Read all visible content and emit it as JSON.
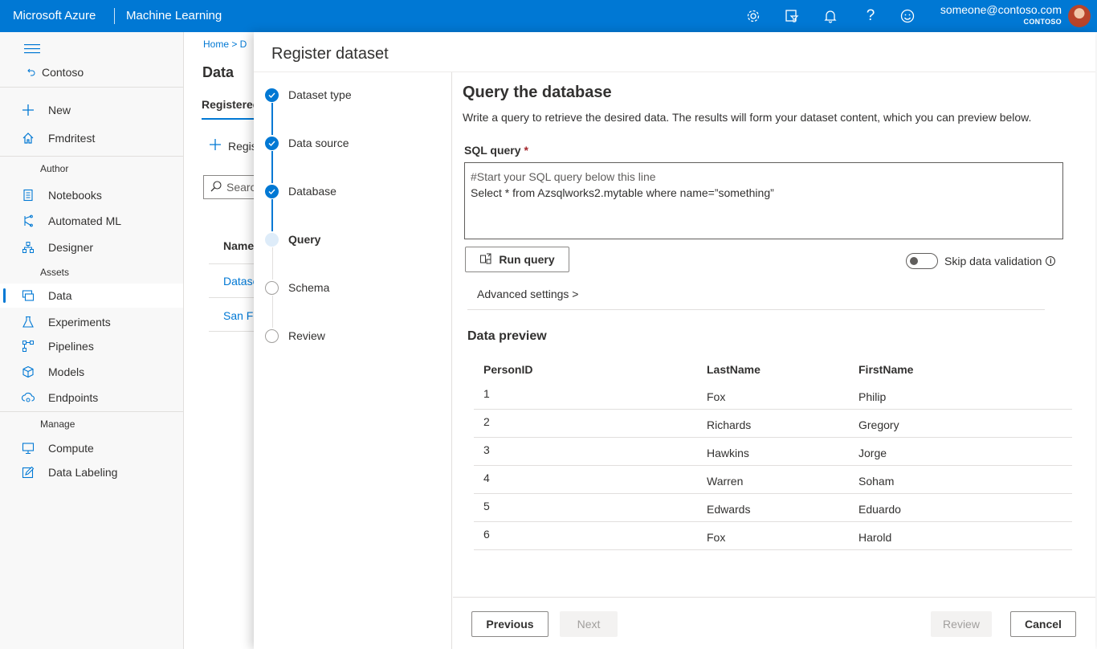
{
  "topbar": {
    "brand": "Microsoft Azure",
    "product": "Machine Learning",
    "icons": [
      "gear-icon",
      "filter-icon",
      "bell-icon",
      "help-icon",
      "smiley-icon"
    ],
    "user_email": "someone@contoso.com",
    "user_org": "CONTOSO"
  },
  "sidebar": {
    "workspace": "Contoso",
    "items_top": [
      {
        "label": "New",
        "icon": "plus-icon"
      },
      {
        "label": "Fmdritest",
        "icon": "home-icon"
      }
    ],
    "author_header": "Author",
    "author_items": [
      {
        "label": "Notebooks",
        "icon": "notebook-icon"
      },
      {
        "label": "Automated ML",
        "icon": "automl-icon"
      },
      {
        "label": "Designer",
        "icon": "designer-icon"
      }
    ],
    "assets_header": "Assets",
    "assets_items": [
      {
        "label": "Data",
        "icon": "data-icon",
        "active": true
      },
      {
        "label": "Experiments",
        "icon": "flask-icon"
      },
      {
        "label": "Pipelines",
        "icon": "pipeline-icon"
      },
      {
        "label": "Models",
        "icon": "cube-icon"
      },
      {
        "label": "Endpoints",
        "icon": "endpoint-icon"
      }
    ],
    "manage_header": "Manage",
    "manage_items": [
      {
        "label": "Compute",
        "icon": "monitor-icon"
      },
      {
        "label": "Data Labeling",
        "icon": "edit-icon"
      }
    ]
  },
  "background_page": {
    "breadcrumb": "Home  >  D",
    "title": "Data",
    "tab": "Registered",
    "register_label": "Regis",
    "search_placeholder": "Searc",
    "name_header": "Name",
    "links": [
      "Datase",
      "San Fr"
    ]
  },
  "panel": {
    "title": "Register dataset",
    "steps": [
      {
        "label": "Dataset type",
        "state": "done"
      },
      {
        "label": "Data source",
        "state": "done"
      },
      {
        "label": "Database",
        "state": "done"
      },
      {
        "label": "Query",
        "state": "current"
      },
      {
        "label": "Schema",
        "state": "todo"
      },
      {
        "label": "Review",
        "state": "todo"
      }
    ],
    "content": {
      "title": "Query the database",
      "description": "Write a query to retrieve the desired data. The results will form your dataset content, which you can preview below.",
      "sql_label": "SQL query",
      "required_mark": "*",
      "sql_line1": "#Start your SQL query below this line",
      "sql_line2": "Select * from Azsqlworks2.mytable where name=”something”",
      "run_query": "Run query",
      "skip_validation": "Skip data validation",
      "skip_validation_on": false,
      "advanced": "Advanced settings >",
      "preview_title": "Data preview",
      "columns": [
        "PersonID",
        "LastName",
        "FirstName"
      ],
      "rows": [
        [
          "1",
          "Fox",
          "Philip"
        ],
        [
          "2",
          "Richards",
          "Gregory"
        ],
        [
          "3",
          "Hawkins",
          "Jorge"
        ],
        [
          "4",
          "Warren",
          "Soham"
        ],
        [
          "5",
          "Edwards",
          "Eduardo"
        ],
        [
          "6",
          "Fox",
          "Harold"
        ]
      ]
    },
    "footer": {
      "previous": "Previous",
      "next": "Next",
      "review": "Review",
      "cancel": "Cancel"
    }
  },
  "colors": {
    "accent": "#0078d4",
    "required": "#a4262c"
  }
}
